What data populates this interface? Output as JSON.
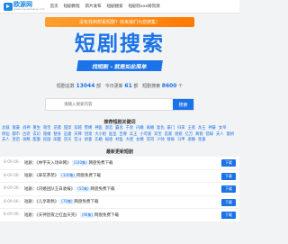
{
  "nav": {
    "logo_text": "欧源网",
    "logo_sub": "www.ouyuanwang.com",
    "links": [
      "首页",
      "短剧教程",
      "新片发布",
      "短剧搜索",
      "短剧热xxx榜资源"
    ]
  },
  "banner": "没有找到想看短剧？快来我们为您搜集！",
  "hero": {
    "title": "短剧搜索",
    "subtitle": "找短剧 - 就是如此简单"
  },
  "stats": {
    "label_total": "短剧总数",
    "total": "13044",
    "unit1": "部",
    "label_today": "今日更新",
    "today": "61",
    "unit2": "部",
    "label_search": "短剧搜索",
    "search": "8600",
    "unit3": "个"
  },
  "search": {
    "placeholder": "请输入搜索内容",
    "button": "搜索"
  },
  "hot": {
    "title": "推荐短剧关键词",
    "words": [
      "总裁",
      "富豪",
      "战神",
      "重生",
      "萌宝",
      "逆袭",
      "甜宠",
      "穿越",
      "赘婿",
      "神医",
      "虐恋",
      "霸总",
      "千金",
      "闪婚",
      "离婚",
      "复仇",
      "豪门",
      "归来",
      "王者",
      "龙王",
      "神豪",
      "女帝",
      "修仙",
      "都市",
      "古装",
      "玄幻",
      "隐婚",
      "替身",
      "追妻",
      "天降",
      "团宠",
      "大小姐",
      "医圣",
      "至尊",
      "兵王",
      "小可爱",
      "双宝",
      "首富",
      "姐姐",
      "亿万",
      "真假",
      "错嫁",
      "夫人",
      "傲娇",
      "夫人",
      "皇后",
      "攻略",
      "甜蜜",
      "民国",
      "闺蜜",
      "逆天",
      "宫斗",
      "娇妻",
      "先婚",
      "报恩",
      "村医",
      "大佬",
      "女婿",
      "哥哥",
      "少帅",
      "替嫁",
      "马甲",
      "退婚",
      "宠妻"
    ]
  },
  "latest": {
    "title": "最新更新短剧",
    "rows": [
      {
        "time": "8-09 06:",
        "text": "短剧：《林宇天入场命网》",
        "badge": "(100集)",
        "suffix": "网盘免费下载",
        "btn": "下载"
      },
      {
        "time": "8-09 06:",
        "text": "短剧：《翠花茶苑》",
        "badge": "(100集)",
        "suffix": "网盘免费下载",
        "btn": "下载"
      },
      {
        "time": "8-09 06:",
        "text": "短剧：《闪婚团队王日收报》",
        "badge": "(55集)",
        "suffix": "网盘免费下载",
        "btn": "下载"
      },
      {
        "time": "8-09 06:",
        "text": "短剧：《儿亭刺佩》",
        "badge": "(70集)",
        "suffix": "网盘免费下载",
        "btn": "下载"
      },
      {
        "time": "8-09 06:",
        "text": "短剧：《天神因夜之红血天壳》",
        "badge": "(96集)",
        "suffix": "网盘免费下载",
        "btn": "下载"
      }
    ]
  }
}
